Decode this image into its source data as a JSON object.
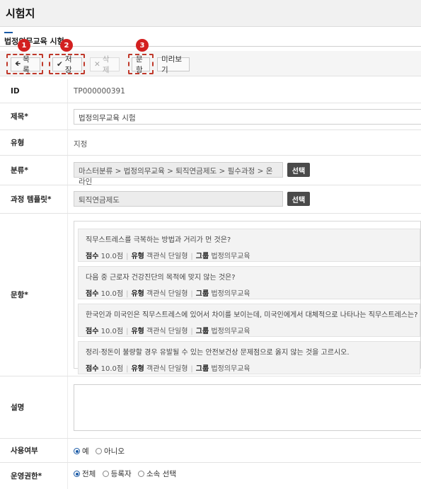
{
  "page": {
    "title": "시험지",
    "subtitle": "법정의무교육 시험"
  },
  "toolbar": {
    "list_label": "목록",
    "save_label": "저장",
    "delete_label": "삭제",
    "questions_label": "문항",
    "preview_label": "미리보기"
  },
  "markers": [
    "1",
    "2",
    "3"
  ],
  "form": {
    "id": {
      "label": "ID",
      "value": "TP000000391"
    },
    "title": {
      "label": "제목*",
      "value": "법정의무교육 시험"
    },
    "type": {
      "label": "유형",
      "value": "지정"
    },
    "category": {
      "label": "분류*",
      "value": "마스터분류 > 법정의무교육 > 퇴직연금제도 > 필수과정 > 온라인",
      "button": "선택"
    },
    "template": {
      "label": "과정 템플릿*",
      "value": "퇴직연금제도",
      "button": "선택"
    },
    "questions": {
      "label": "문항*",
      "items": [
        {
          "text": "직무스트레스를 극복하는 방법과 거리가 먼 것은?",
          "score_label": "점수",
          "score": "10.0점",
          "type_label": "유형",
          "type": "객관식 단일형",
          "group_label": "그룹",
          "group": "법정의무교육"
        },
        {
          "text": "다음 중 근로자 건강진단의 목적에 맞지 않는 것은?",
          "score_label": "점수",
          "score": "10.0점",
          "type_label": "유형",
          "type": "객관식 단일형",
          "group_label": "그룹",
          "group": "법정의무교육"
        },
        {
          "text": "한국인과 미국인은 직무스트레스에 있어서 차이를 보이는데, 미국인에게서 대체적으로 나타나는 직무스트레스는?",
          "score_label": "점수",
          "score": "10.0점",
          "type_label": "유형",
          "type": "객관식 단일형",
          "group_label": "그룹",
          "group": "법정의무교육"
        },
        {
          "text": "정리·정돈이 불량할 경우 유발될 수 있는 안전보건상 문제점으로 옳지 않는 것을 고르시오.",
          "score_label": "점수",
          "score": "10.0점",
          "type_label": "유형",
          "type": "객관식 단일형",
          "group_label": "그룹",
          "group": "법정의무교육"
        }
      ]
    },
    "description": {
      "label": "설명",
      "value": ""
    },
    "usage": {
      "label": "사용여부",
      "options": [
        "예",
        "아니오"
      ],
      "selected": "예"
    },
    "auth": {
      "label": "운영권한*",
      "options": [
        "전체",
        "등록자",
        "소속 선택"
      ],
      "selected": "전체"
    }
  },
  "colors": {
    "accent": "#1a5aa6",
    "marker": "#d32020",
    "dark_button": "#4a4a4a"
  }
}
